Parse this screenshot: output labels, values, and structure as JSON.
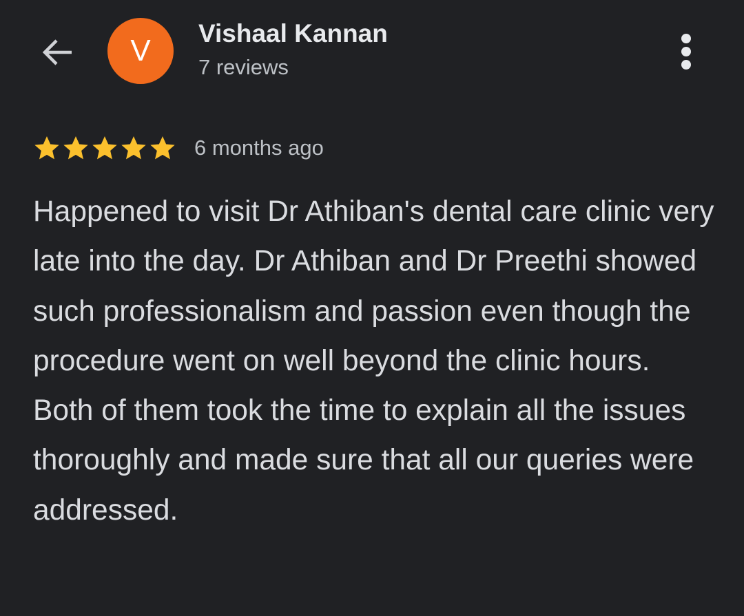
{
  "header": {
    "back_icon": "arrow-back-icon",
    "avatar_letter": "V",
    "avatar_color": "#f26b1d",
    "reviewer_name": "Vishaal Kannan",
    "review_count": "7 reviews",
    "more_icon": "more-vert-icon"
  },
  "review": {
    "rating": 5,
    "rating_max": 5,
    "star_color": "#fbc02d",
    "time": "6 months ago",
    "text": "Happened to visit Dr Athiban's dental care clinic very late into the day. Dr Athiban and Dr Preethi showed such professionalism and passion even though the procedure went on well beyond the clinic hours. Both of them took the time to explain all the issues thoroughly and made sure that all our queries were addressed."
  },
  "theme": {
    "background": "#202124",
    "text_primary": "#e8eaed",
    "text_secondary": "#bdc1c6"
  }
}
